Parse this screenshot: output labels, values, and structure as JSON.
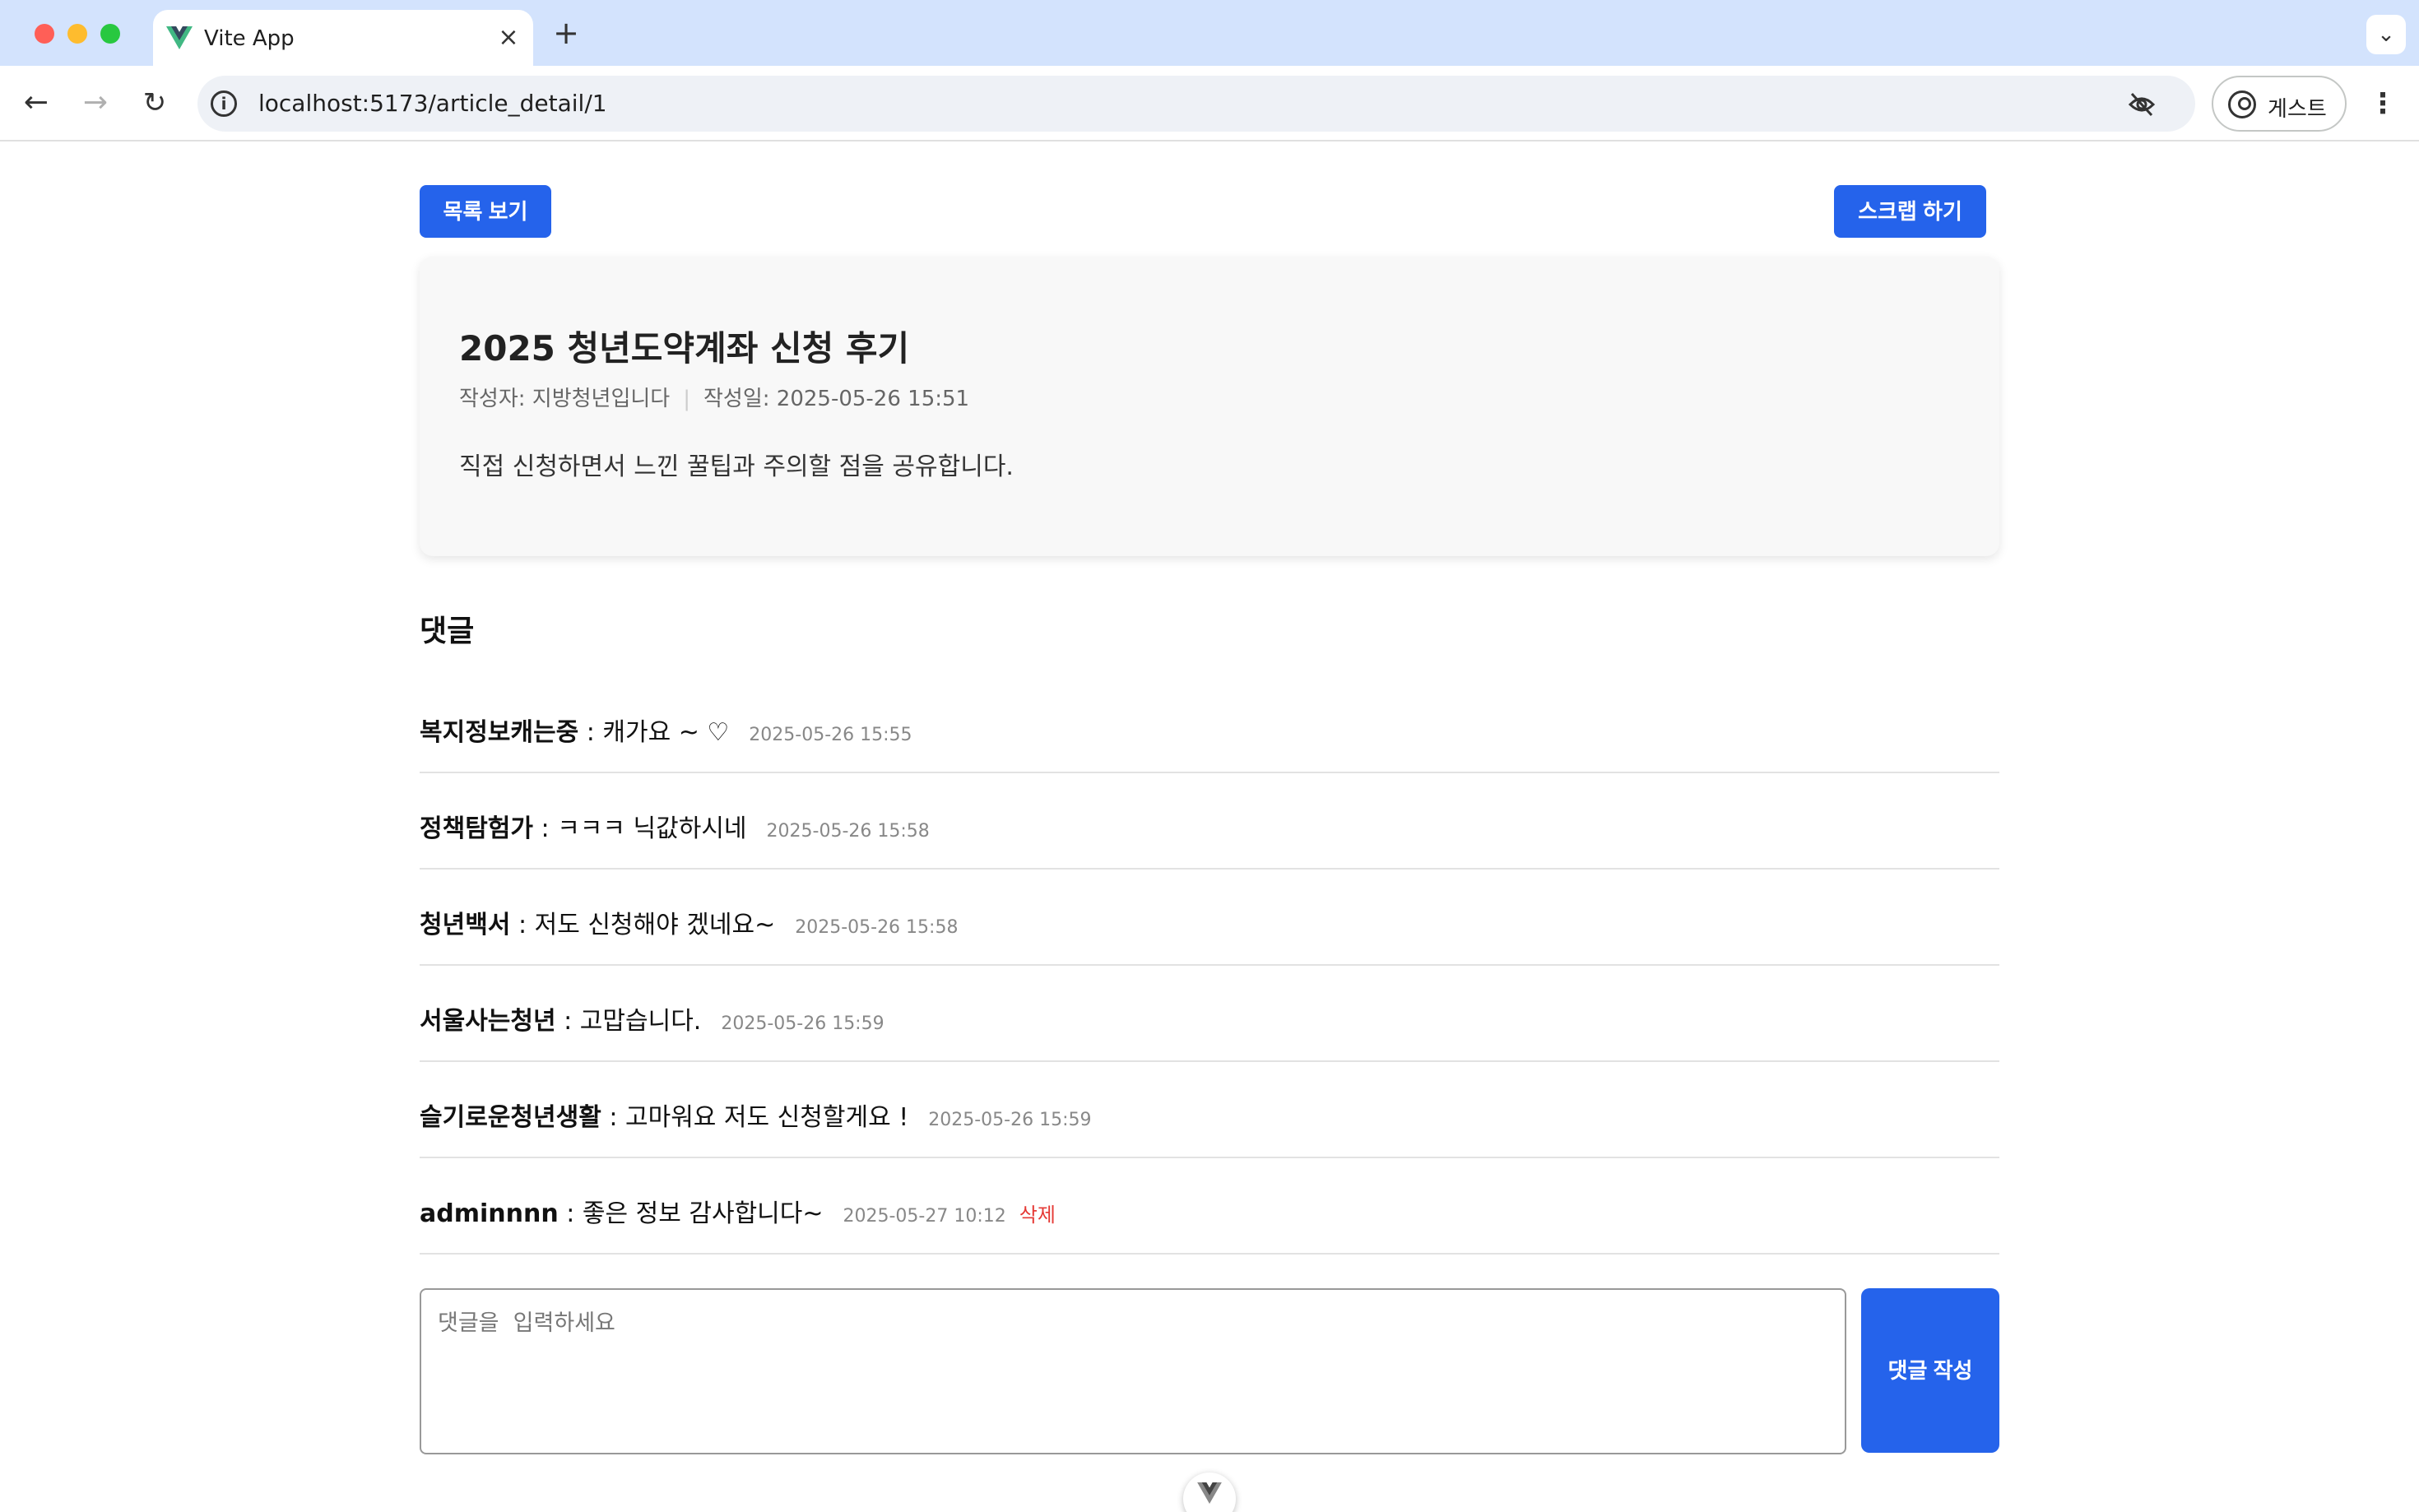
{
  "browser": {
    "tab_title": "Vite App",
    "tab_close": "×",
    "new_tab": "+",
    "tab_menu": "⌄",
    "url": "localhost:5173/article_detail/1",
    "profile_label": "게스트",
    "menu": "⋮",
    "nav": {
      "back": "←",
      "forward": "→",
      "reload": "↻"
    }
  },
  "page": {
    "list_button": "목록 보기",
    "scrap_button": "스크랩 하기",
    "article": {
      "title": "2025 청년도약계좌 신청 후기",
      "author": "작성자: 지방청년입니다",
      "separator": "|",
      "date": "작성일: 2025-05-26 15:51",
      "body": "직접 신청하면서 느낀 꿀팁과 주의할 점을 공유합니다."
    },
    "comments_heading": "댓글",
    "comments": [
      {
        "author": "복지정보캐는중",
        "sep": " : ",
        "text": "캐가요 ~ ♡",
        "date": "2025-05-26 15:55"
      },
      {
        "author": "정책탐험가",
        "sep": " : ",
        "text": "ㅋㅋㅋ 닉값하시네",
        "date": "2025-05-26 15:58"
      },
      {
        "author": "청년백서",
        "sep": " : ",
        "text": "저도 신청해야 겠네요~",
        "date": "2025-05-26 15:58"
      },
      {
        "author": "서울사는청년",
        "sep": " : ",
        "text": "고맙습니다.",
        "date": "2025-05-26 15:59"
      },
      {
        "author": "슬기로운청년생활",
        "sep": " : ",
        "text": "고마워요 저도 신청할게요 !",
        "date": "2025-05-26 15:59"
      },
      {
        "author": "adminnnn",
        "sep": " : ",
        "text": "좋은 정보 감사합니다~",
        "date": "2025-05-27 10:12",
        "delete": "삭제"
      }
    ],
    "comment_placeholder": "댓글을  입력하세요",
    "submit_button": "댓글 작성"
  },
  "colors": {
    "primary": "#2563eb",
    "delete": "#e53935",
    "tabbar": "#d3e3fd"
  },
  "icons": [
    "vue-logo-icon",
    "info-icon",
    "eye-off-icon",
    "profile-icon",
    "vue-devtools-icon"
  ]
}
